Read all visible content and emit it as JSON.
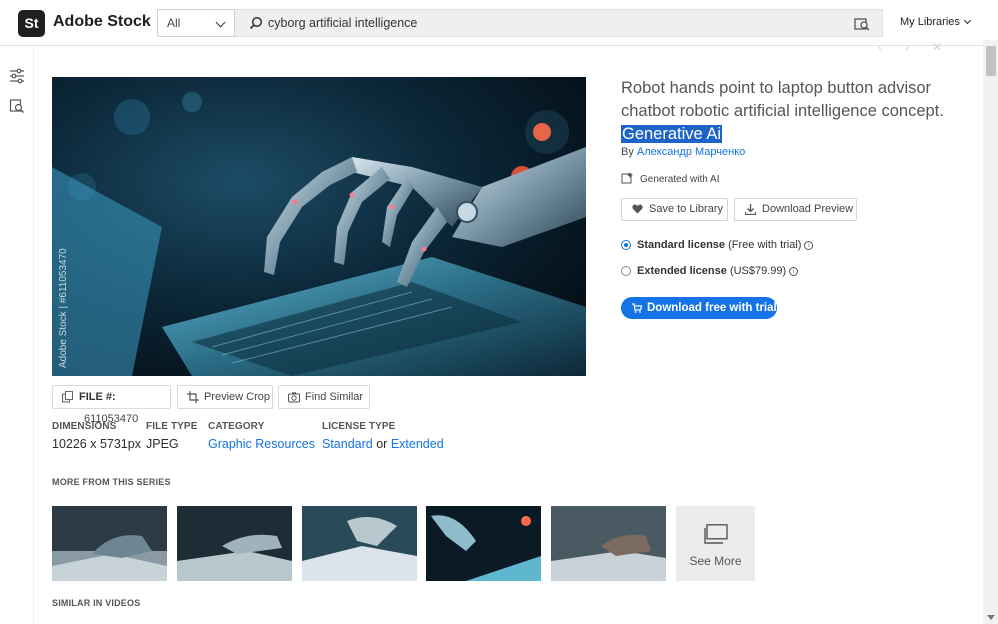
{
  "header": {
    "logo_mark": "St",
    "brand": "Adobe Stock",
    "filter": "All",
    "search_value": "cyborg artificial intelligence",
    "my_libraries": "My Libraries"
  },
  "image": {
    "watermark": "Adobe Stock | #611053470"
  },
  "asset": {
    "title_part1": "Robot hands point to laptop button advisor chatbot robotic artificial intelligence concept.",
    "title_highlight": "Generative Ai",
    "by": "By",
    "author": "Александр Марченко",
    "generated": "Generated with AI",
    "save_label": "Save to Library",
    "download_preview": "Download Preview"
  },
  "license": {
    "standard_label": "Standard license",
    "standard_note": "(Free with trial)",
    "extended_label": "Extended license",
    "extended_note": "(US$79.99)",
    "cta": "Download free with trial"
  },
  "tools": {
    "file_label": "FILE #:",
    "file_number": "611053470",
    "preview_crop": "Preview Crop",
    "find_similar": "Find Similar"
  },
  "meta": {
    "dimensions_label": "DIMENSIONS",
    "dimensions_value": "10226 x 5731px",
    "filetype_label": "FILE TYPE",
    "filetype_value": "JPEG",
    "category_label": "CATEGORY",
    "category_value": "Graphic Resources",
    "licensetype_label": "LICENSE TYPE",
    "licensetype_standard": "Standard",
    "licensetype_or": "or",
    "licensetype_extended": "Extended"
  },
  "series": {
    "title": "MORE FROM THIS SERIES",
    "see_more": "See More"
  },
  "similar_videos": {
    "title": "SIMILAR IN VIDEOS"
  },
  "colors": {
    "accent": "#1473e6",
    "highlight": "#1e64c8"
  }
}
